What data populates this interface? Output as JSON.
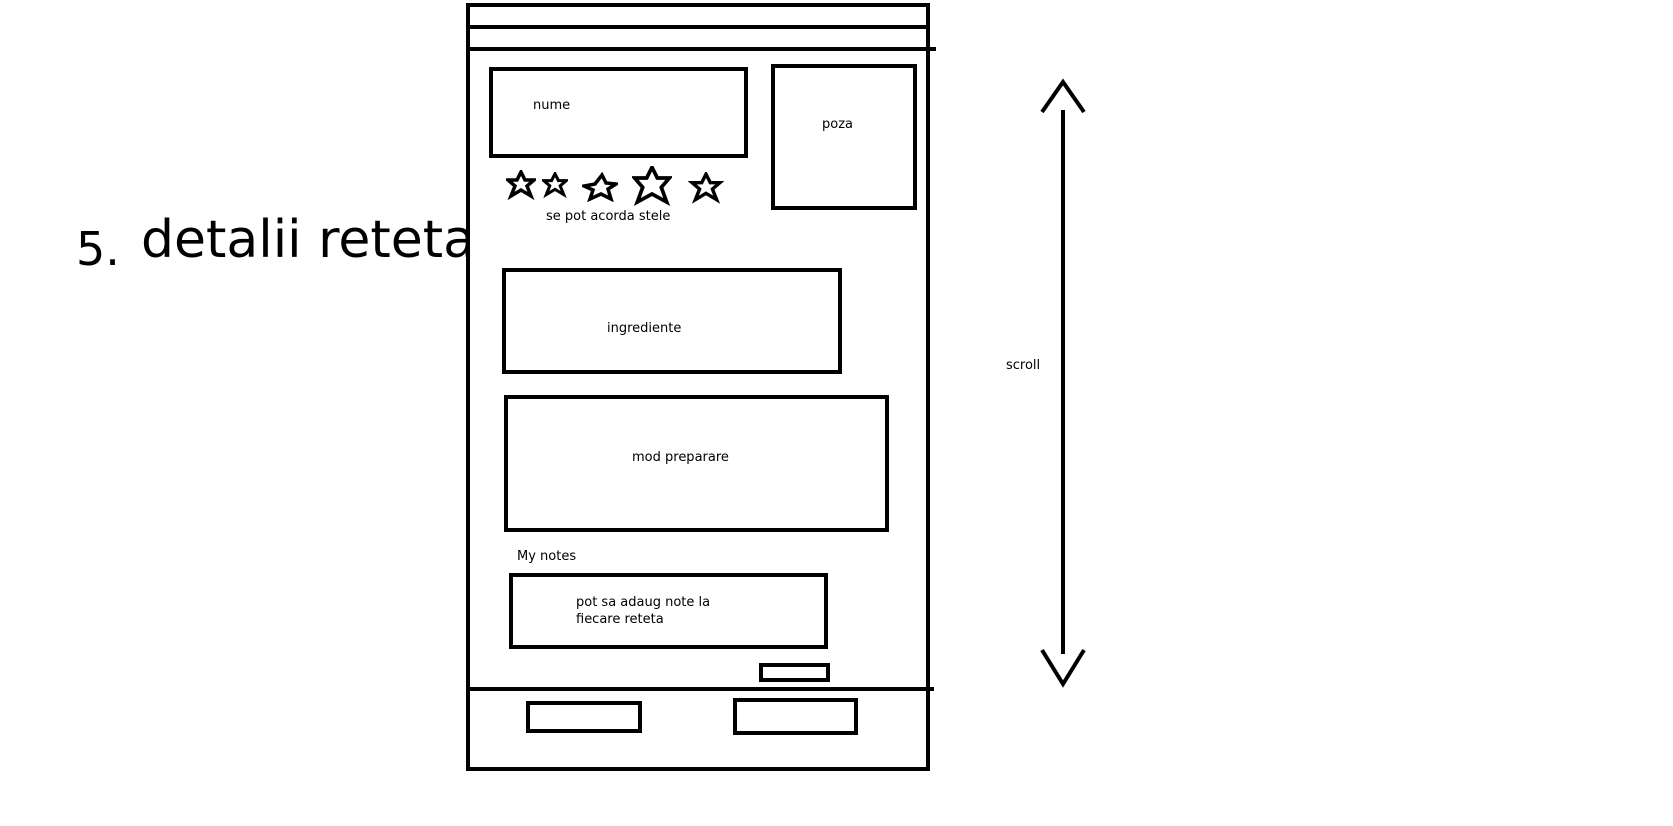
{
  "heading": {
    "number": "5.",
    "title": "detalii reteta"
  },
  "recipe": {
    "name_label": "nume",
    "photo_label": "poza",
    "rating_caption": "se pot acorda stele",
    "rating_stars": 5,
    "ingredients_label": "ingrediente",
    "preparation_label": "mod preparare",
    "notes_title": "My notes",
    "notes_text_line1": "pot sa adaug note la",
    "notes_text_line2": "fiecare reteta"
  },
  "scroll": {
    "label": "scroll"
  },
  "icons": {
    "star": "star-icon",
    "scroll_up": "arrow-up-icon",
    "scroll_down": "arrow-down-icon"
  }
}
